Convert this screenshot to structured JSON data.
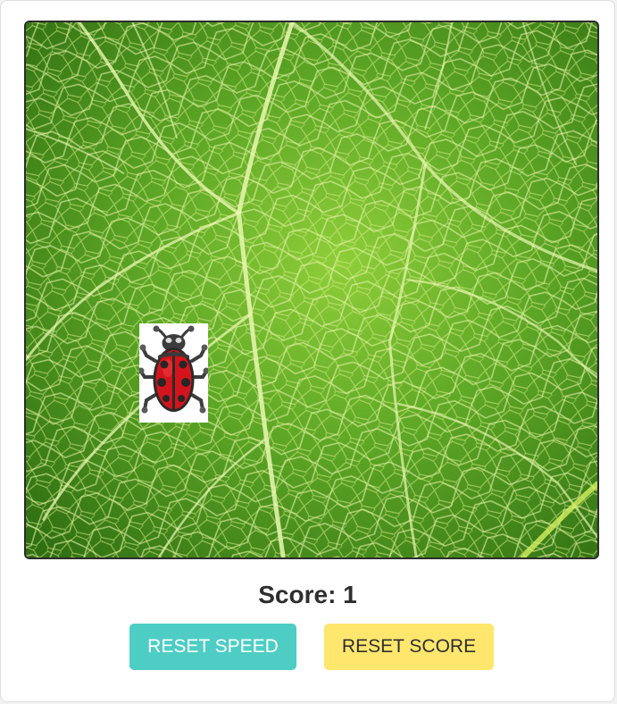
{
  "game": {
    "board_background": "leaf-texture",
    "bug_icon": "ladybug-icon"
  },
  "score": {
    "label": "Score: 1",
    "value": 1
  },
  "controls": {
    "reset_speed_label": "RESET SPEED",
    "reset_score_label": "RESET SCORE"
  },
  "colors": {
    "reset_speed_bg": "#4ecdc4",
    "reset_speed_text": "#ffffff",
    "reset_score_bg": "#ffe66d",
    "reset_score_text": "#2e2e2e",
    "leaf_green": "#4f9a1f",
    "ladybug_red": "#d4141c"
  }
}
